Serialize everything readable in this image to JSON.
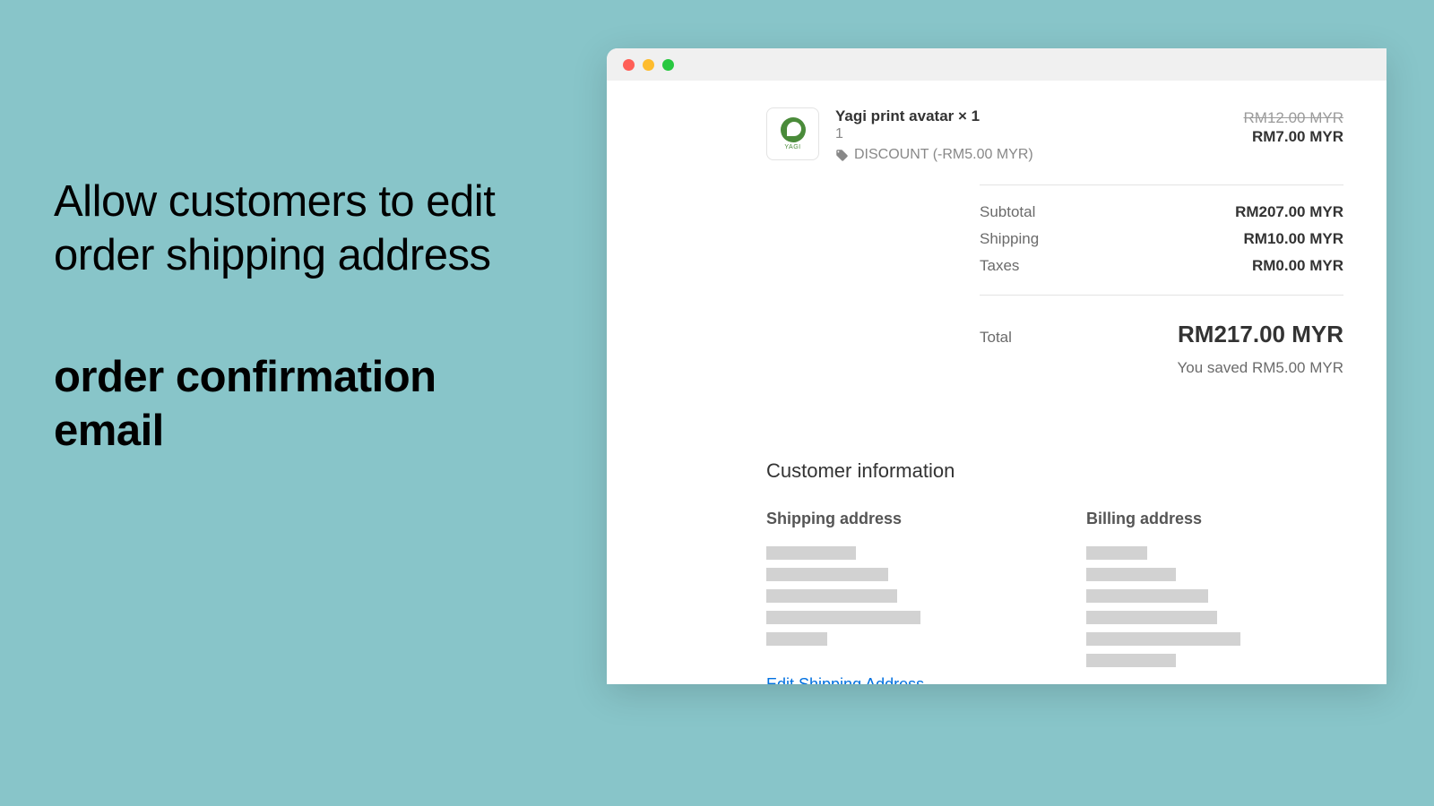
{
  "promo": {
    "line1": "Allow customers to edit order shipping address",
    "line2": "order confirmation email"
  },
  "lineItem": {
    "name": "Yagi print avatar × 1",
    "qty": "1",
    "discountText": "DISCOUNT (-RM5.00 MYR)",
    "thumbLabel": "YAGI",
    "priceOriginal": "RM12.00 MYR",
    "priceFinal": "RM7.00 MYR"
  },
  "totals": {
    "subtotalLabel": "Subtotal",
    "subtotalValue": "RM207.00 MYR",
    "shippingLabel": "Shipping",
    "shippingValue": "RM10.00 MYR",
    "taxesLabel": "Taxes",
    "taxesValue": "RM0.00 MYR",
    "totalLabel": "Total",
    "totalValue": "RM217.00 MYR",
    "savings": "You saved RM5.00 MYR"
  },
  "customer": {
    "sectionTitle": "Customer information",
    "shippingHeading": "Shipping address",
    "billingHeading": "Billing address",
    "editLink": "Edit Shipping Address"
  }
}
